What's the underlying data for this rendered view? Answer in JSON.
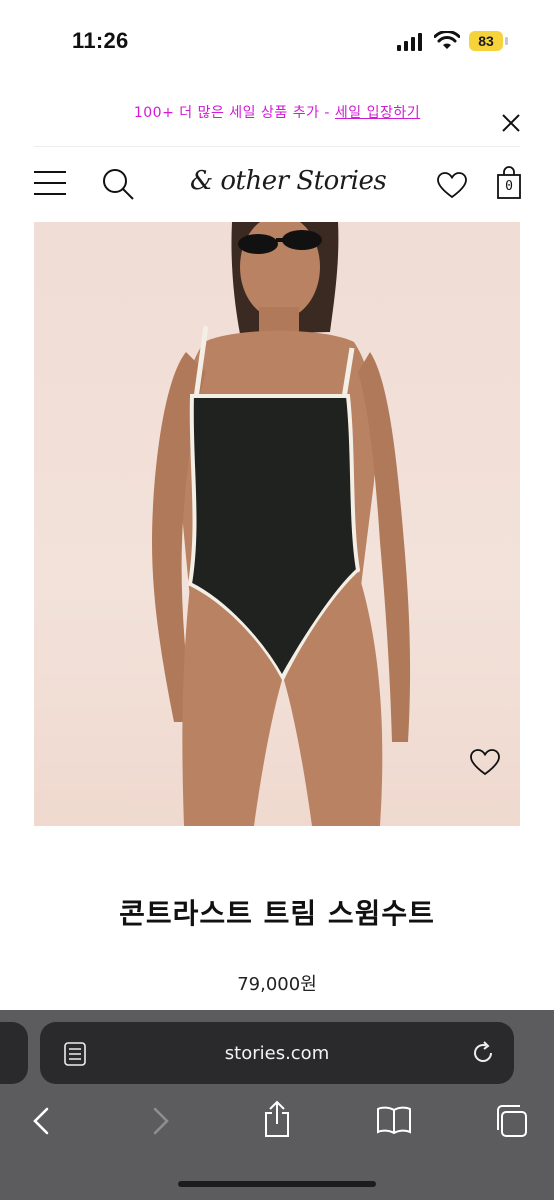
{
  "status_bar": {
    "time": "11:26",
    "battery": "83",
    "icons": [
      "signal-icon",
      "wifi-icon"
    ]
  },
  "promo": {
    "text": "100+ 더 많은 세일 상품 추가 - ",
    "link": "세일 입장하기",
    "color": "#d21ad6"
  },
  "header": {
    "logo": "& other Stories",
    "bag_count": "0"
  },
  "product": {
    "title": "콘트라스트 트림 스윔수트",
    "price": "79,000원"
  },
  "browser": {
    "url": "stories.com"
  }
}
